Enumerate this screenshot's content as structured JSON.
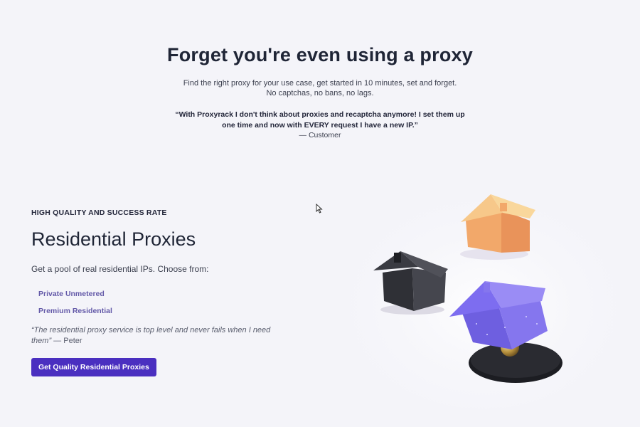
{
  "hero": {
    "title": "Forget you're even using a proxy",
    "subtitle_line1": "Find the right proxy for your use case, get started in 10 minutes, set and forget.",
    "subtitle_line2": "No captchas, no bans, no lags.",
    "quote": "“With Proxyrack I don't think about proxies and recaptcha anymore! I set them up one time and now with EVERY request I have a new IP.”",
    "attribution": "— Customer"
  },
  "residential": {
    "eyebrow": "HIGH QUALITY AND SUCCESS RATE",
    "title": "Residential Proxies",
    "description": "Get a pool of real residential IPs. Choose from:",
    "options": [
      {
        "label": "Private Unmetered"
      },
      {
        "label": "Premium Residential"
      }
    ],
    "testimonial_quote": "“The residential proxy service is top level and never fails when I need them”",
    "testimonial_author": " — Peter",
    "cta_label": "Get Quality Residential Proxies"
  },
  "colors": {
    "background": "#f4f4f9",
    "accent": "#4a2fc0",
    "link": "#6359a8",
    "heading": "#1f2536"
  },
  "icons": {
    "cursor": "mouse-pointer-icon",
    "illustration": "houses-illustration"
  }
}
